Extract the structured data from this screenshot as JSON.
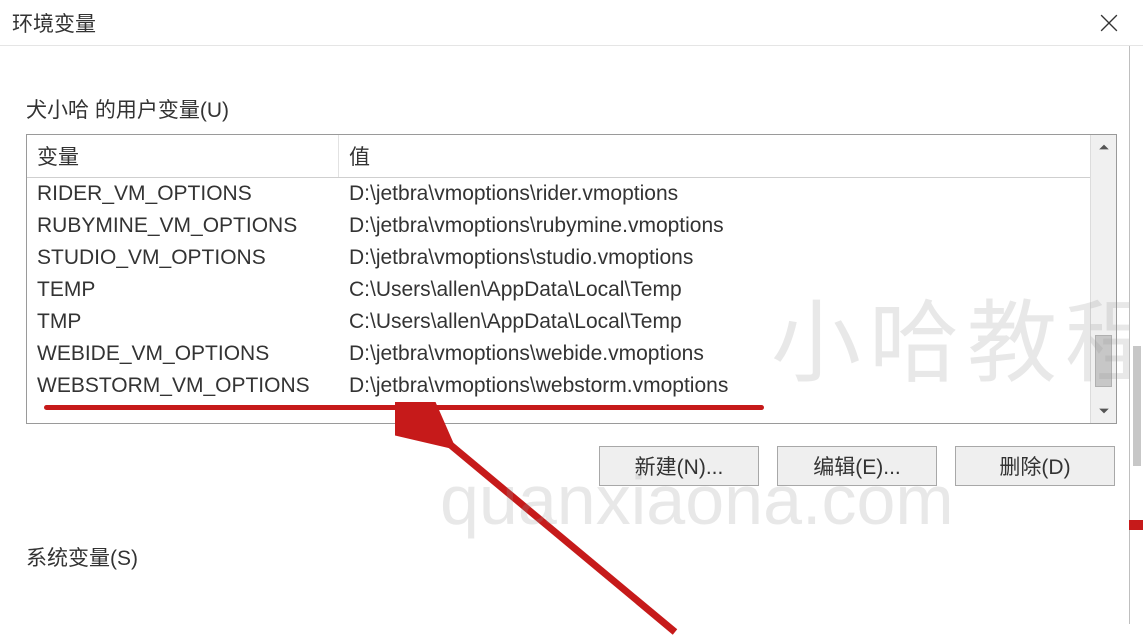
{
  "window": {
    "title": "环境变量"
  },
  "userVars": {
    "sectionLabel": "犬小哈 的用户变量(U)",
    "columns": {
      "name": "变量",
      "value": "值"
    },
    "rows": [
      {
        "name": "RIDER_VM_OPTIONS",
        "value": "D:\\jetbra\\vmoptions\\rider.vmoptions"
      },
      {
        "name": "RUBYMINE_VM_OPTIONS",
        "value": "D:\\jetbra\\vmoptions\\rubymine.vmoptions"
      },
      {
        "name": "STUDIO_VM_OPTIONS",
        "value": "D:\\jetbra\\vmoptions\\studio.vmoptions"
      },
      {
        "name": "TEMP",
        "value": "C:\\Users\\allen\\AppData\\Local\\Temp"
      },
      {
        "name": "TMP",
        "value": "C:\\Users\\allen\\AppData\\Local\\Temp"
      },
      {
        "name": "WEBIDE_VM_OPTIONS",
        "value": "D:\\jetbra\\vmoptions\\webide.vmoptions"
      },
      {
        "name": "WEBSTORM_VM_OPTIONS",
        "value": "D:\\jetbra\\vmoptions\\webstorm.vmoptions"
      }
    ]
  },
  "buttons": {
    "new": "新建(N)...",
    "edit": "编辑(E)...",
    "delete": "删除(D)"
  },
  "systemVars": {
    "sectionLabel": "系统变量(S)"
  },
  "watermarks": {
    "w1": "小哈教程",
    "w2": "quanxiaona.com"
  }
}
